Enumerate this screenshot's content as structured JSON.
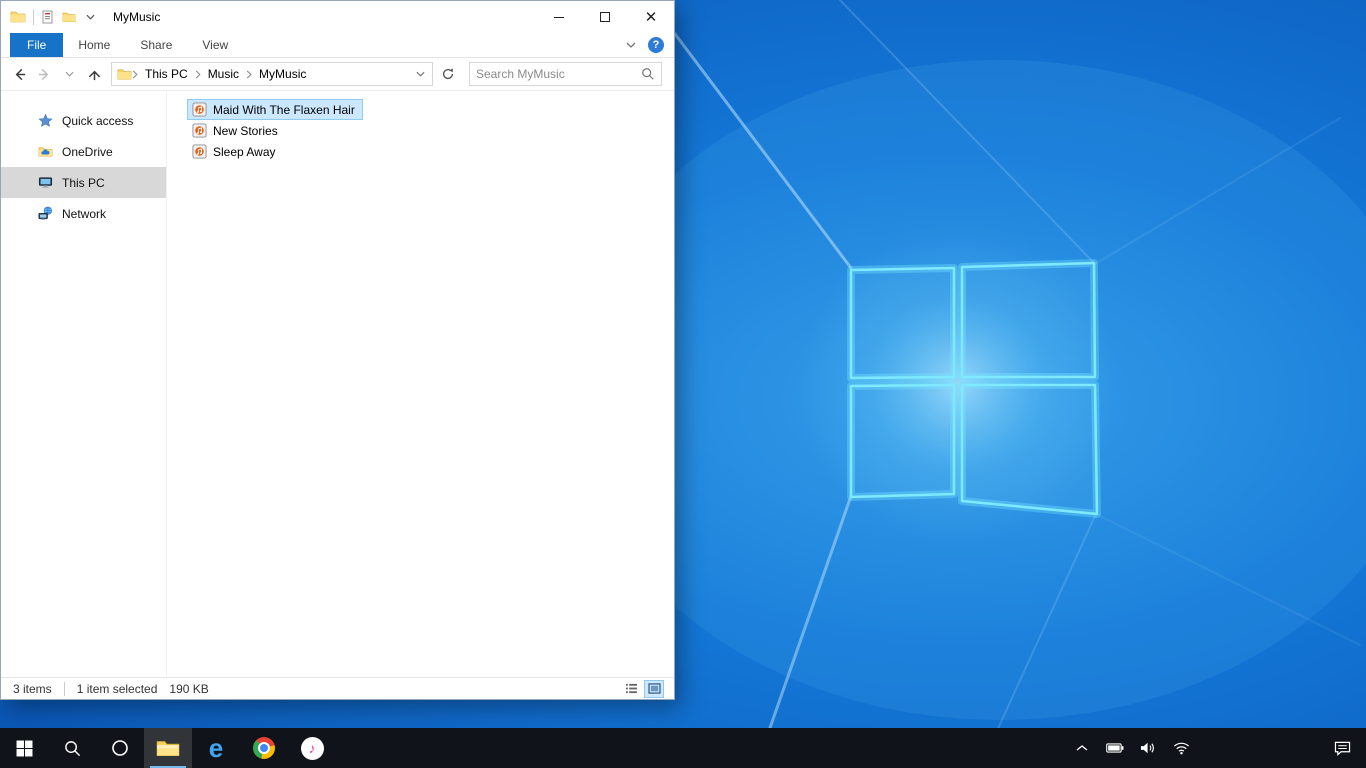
{
  "titlebar": {
    "title": "MyMusic"
  },
  "ribbon": {
    "file_tab": "File",
    "tabs": [
      {
        "label": "Home"
      },
      {
        "label": "Share"
      },
      {
        "label": "View"
      }
    ],
    "help": "?"
  },
  "addressbar": {
    "breadcrumb": [
      {
        "label": "This PC"
      },
      {
        "label": "Music"
      },
      {
        "label": "MyMusic"
      }
    ],
    "search_placeholder": "Search MyMusic"
  },
  "sidebar": {
    "items": [
      {
        "label": "Quick access",
        "icon": "star-icon",
        "selected": false
      },
      {
        "label": "OneDrive",
        "icon": "onedrive-icon",
        "selected": false
      },
      {
        "label": "This PC",
        "icon": "pc-icon",
        "selected": true
      },
      {
        "label": "Network",
        "icon": "network-icon",
        "selected": false
      }
    ]
  },
  "files": [
    {
      "name": "Maid With The Flaxen Hair",
      "selected": true
    },
    {
      "name": "New Stories",
      "selected": false
    },
    {
      "name": "Sleep Away",
      "selected": false
    }
  ],
  "statusbar": {
    "item_count": "3 items",
    "selection_count": "1 item selected",
    "selection_size": "190 KB"
  },
  "taskbar": {
    "apps": [
      {
        "name": "start"
      },
      {
        "name": "search"
      },
      {
        "name": "cortana"
      },
      {
        "name": "file-explorer",
        "active": true
      },
      {
        "name": "edge"
      },
      {
        "name": "chrome"
      },
      {
        "name": "itunes"
      }
    ],
    "tray": [
      "chevron-up",
      "battery",
      "volume",
      "network",
      "action-center"
    ]
  },
  "colors": {
    "file_tab_blue": "#1673c8",
    "selection_bg": "#cce8ff",
    "selection_border": "#8fcbf5",
    "sidebar_selected": "#d8d8d8",
    "taskbar_bg": "#101319",
    "wallpaper_logo_stroke": "#7feaff"
  }
}
